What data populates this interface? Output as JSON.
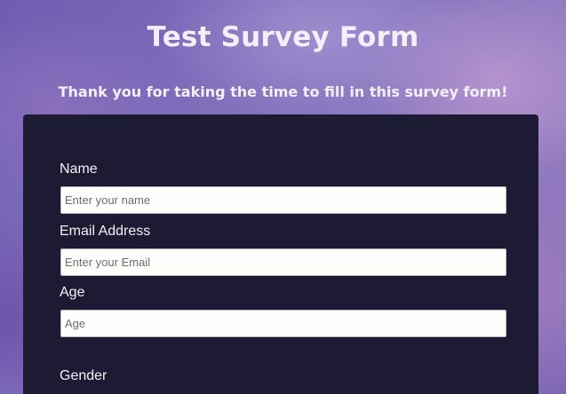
{
  "header": {
    "title": "Test Survey Form",
    "description": "Thank you for taking the time to fill in this survey form!"
  },
  "form": {
    "name": {
      "label": "Name",
      "placeholder": "Enter your name",
      "value": ""
    },
    "email": {
      "label": "Email Address",
      "placeholder": "Enter your Email",
      "value": ""
    },
    "age": {
      "label": "Age",
      "placeholder": "Age",
      "value": ""
    },
    "gender": {
      "label": "Gender"
    }
  },
  "colors": {
    "panel_background": "#1c1b33",
    "text_light": "#f2f2f6",
    "input_background": "#fefefd"
  }
}
